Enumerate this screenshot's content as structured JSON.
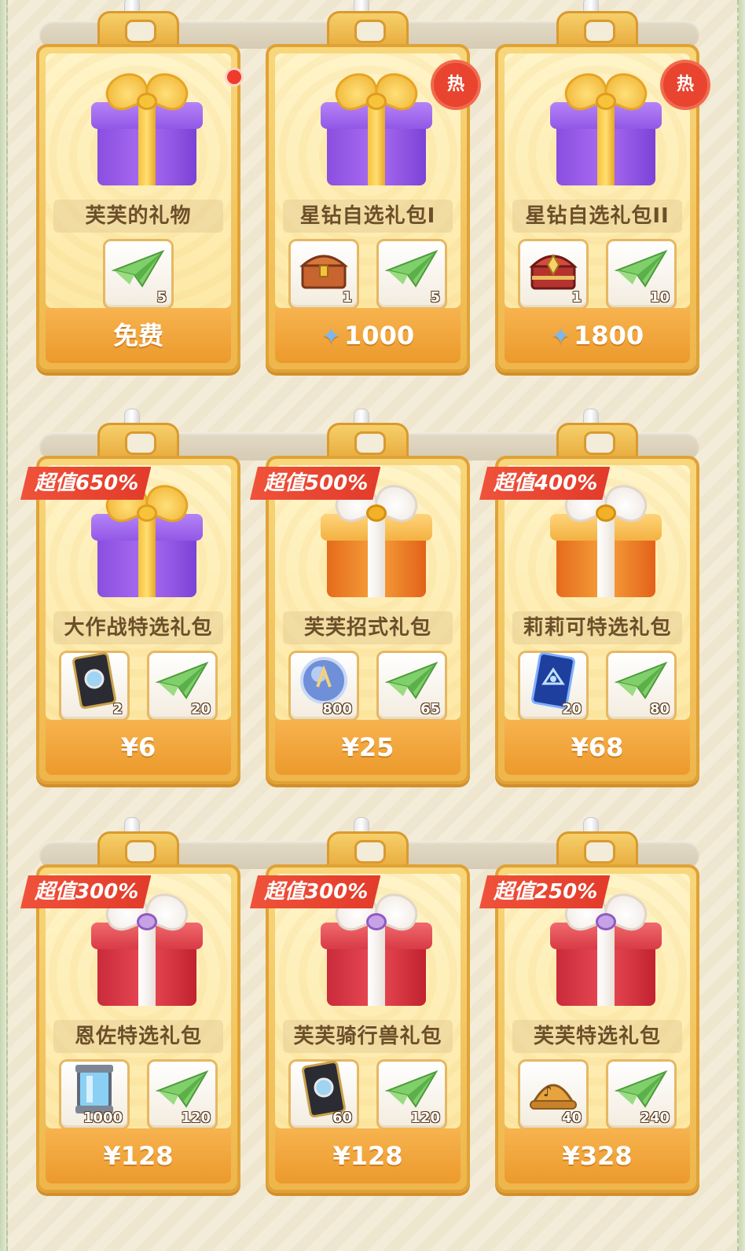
{
  "colors": {
    "card_gold": "#f8d77c",
    "price_orange": "#ec9a2c",
    "hot_red": "#e8442f",
    "ribbon_red": "#e23b2b",
    "shelf": "#d6ccb5"
  },
  "packs": [
    {
      "name": "芙芙的礼物",
      "gift": "purple-gift",
      "items": [
        {
          "icon": "paper-plane-icon",
          "qty": "5"
        }
      ],
      "price": "免费",
      "badge": "red-dot"
    },
    {
      "name": "星钻自选礼包I",
      "gift": "purple-gift",
      "items": [
        {
          "icon": "treasure-chest-icon",
          "qty": "1"
        },
        {
          "icon": "paper-plane-icon",
          "qty": "5"
        }
      ],
      "price": "1000",
      "currency": "star-diamond-icon",
      "badge": "热"
    },
    {
      "name": "星钻自选礼包II",
      "gift": "purple-gift",
      "items": [
        {
          "icon": "jeweled-chest-icon",
          "qty": "1"
        },
        {
          "icon": "paper-plane-icon",
          "qty": "10"
        }
      ],
      "price": "1800",
      "currency": "star-diamond-icon",
      "badge": "热"
    },
    {
      "name": "大作战特选礼包",
      "gift": "purple-gift",
      "items": [
        {
          "icon": "battle-card-icon",
          "qty": "2"
        },
        {
          "icon": "paper-plane-icon",
          "qty": "20"
        }
      ],
      "price": "¥6",
      "ribbon": "超值650%"
    },
    {
      "name": "芙芙招式礼包",
      "gift": "orange-gift",
      "items": [
        {
          "icon": "skill-orb-icon",
          "qty": "800"
        },
        {
          "icon": "paper-plane-icon",
          "qty": "65"
        }
      ],
      "price": "¥25",
      "ribbon": "超值500%"
    },
    {
      "name": "莉莉可特选礼包",
      "gift": "orange-gift",
      "items": [
        {
          "icon": "blue-card-icon",
          "qty": "20"
        },
        {
          "icon": "paper-plane-icon",
          "qty": "80"
        }
      ],
      "price": "¥68",
      "ribbon": "超值400%"
    },
    {
      "name": "恩佐特选礼包",
      "gift": "red-gift",
      "items": [
        {
          "icon": "energy-canister-icon",
          "qty": "1000"
        },
        {
          "icon": "paper-plane-icon",
          "qty": "120"
        }
      ],
      "price": "¥128",
      "ribbon": "超值300%"
    },
    {
      "name": "芙芙骑行兽礼包",
      "gift": "red-gift",
      "items": [
        {
          "icon": "battle-card-icon",
          "qty": "60"
        },
        {
          "icon": "paper-plane-icon",
          "qty": "120"
        }
      ],
      "price": "¥128",
      "ribbon": "超值300%"
    },
    {
      "name": "芙芙特选礼包",
      "gift": "red-gift",
      "items": [
        {
          "icon": "music-hat-icon",
          "qty": "40"
        },
        {
          "icon": "paper-plane-icon",
          "qty": "240"
        }
      ],
      "price": "¥328",
      "ribbon": "超值250%"
    }
  ]
}
